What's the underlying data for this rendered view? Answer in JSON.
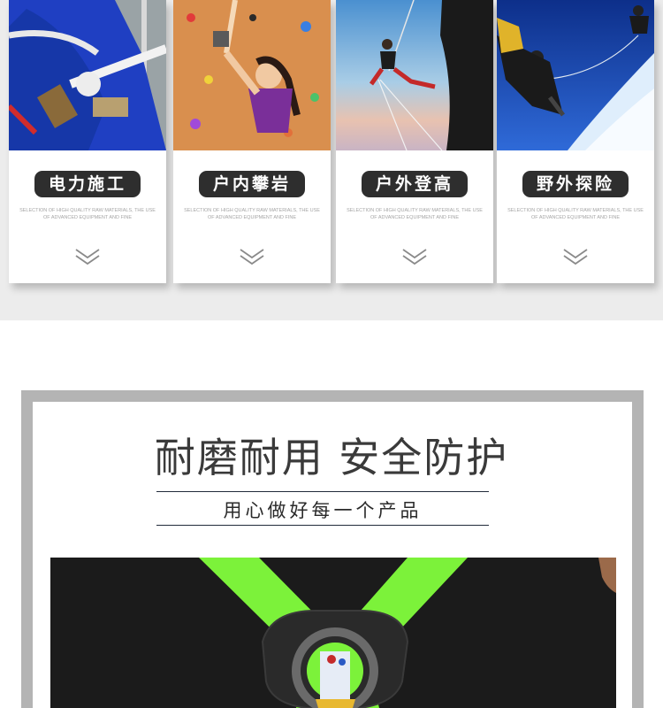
{
  "categories": [
    {
      "title": "电力施工",
      "description": "SELECTION OF HIGH QUALITY RAW MATERIALS, THE USE OF ADVANCED EQUIPMENT AND FINE",
      "photo_icon": "power-construction-worker-photo"
    },
    {
      "title": "户内攀岩",
      "description": "SELECTION OF HIGH QUALITY RAW MATERIALS, THE USE OF ADVANCED EQUIPMENT AND FINE",
      "photo_icon": "indoor-climbing-photo"
    },
    {
      "title": "户外登高",
      "description": "SELECTION OF HIGH QUALITY RAW MATERIALS, THE USE OF ADVANCED EQUIPMENT AND FINE",
      "photo_icon": "outdoor-climbing-photo"
    },
    {
      "title": "野外探险",
      "description": "SELECTION OF HIGH QUALITY RAW MATERIALS, THE USE OF ADVANCED EQUIPMENT AND FINE",
      "photo_icon": "field-expedition-photo"
    }
  ],
  "product_section": {
    "headline": "耐磨耐用 安全防护",
    "tagline": "用心做好每一个产品",
    "photo_icon": "safety-harness-photo"
  },
  "colors": {
    "band_background": "#ececec",
    "pill_background": "#2e2e2e",
    "frame_border": "#b4b4b4",
    "harness_strap": "#7cf23a"
  }
}
